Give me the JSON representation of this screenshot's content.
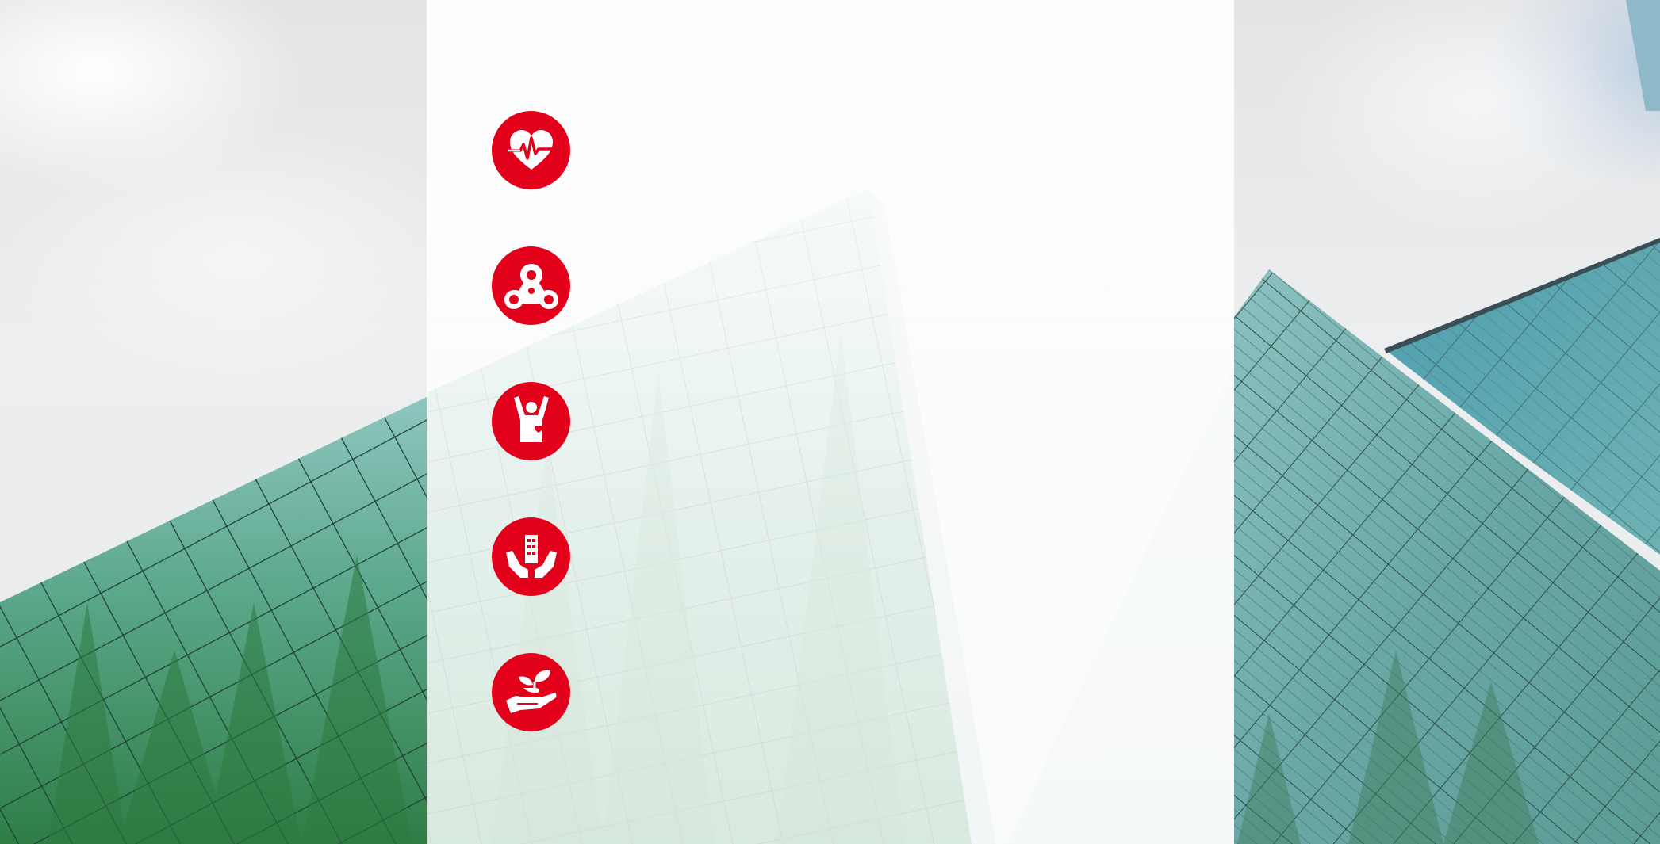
{
  "colors": {
    "accent": "#e2001a",
    "panel": "#ffffff",
    "glass": "#7fb8b2",
    "foliage": "#3f8a55"
  },
  "icons": [
    {
      "name": "heart-pulse-icon"
    },
    {
      "name": "network-nodes-icon"
    },
    {
      "name": "person-cheering-icon"
    },
    {
      "name": "hands-holding-building-icon"
    },
    {
      "name": "hand-holding-plant-icon"
    }
  ]
}
